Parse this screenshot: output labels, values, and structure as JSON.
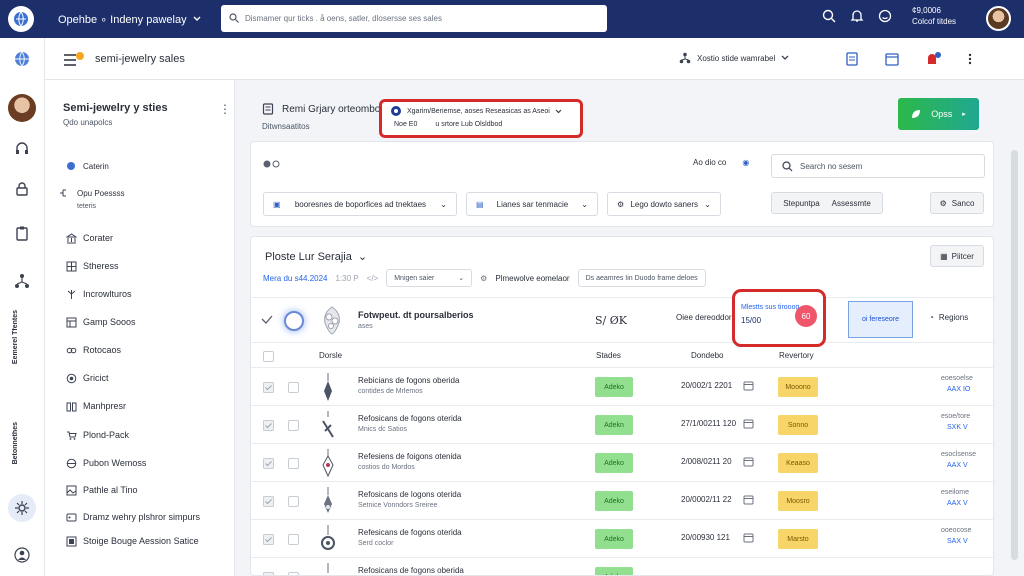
{
  "topbar": {
    "title": "Opehbe ∘ Indeny pawelay",
    "search_placeholder": "Dismamer qur ticks . å oens, satler, dlosersse ses sales",
    "status_line1": "¢9,0006",
    "status_line2": "Colcof titdes"
  },
  "rail": {
    "vtext1": "Eemerel Tfentes",
    "vtext2": "Betonnethes"
  },
  "subheader": {
    "title": "semi-jewelry sales",
    "right_label": "Xostio stide wamrabel"
  },
  "sidebar": {
    "title": "Semi-jewelry y sties",
    "subtitle": "Qdo unapolcs",
    "section_label": "Caterin",
    "section2_title": "Opu Poessss",
    "section2_sub": "teteris",
    "items": [
      "Corater",
      "Stheress",
      "Incrowlturos",
      "Gamp Sooos",
      "Rotocaos",
      "Gricict",
      "Manhpresr",
      "Plond-Pack",
      "Pubon Wemoss",
      "Pathle al Tino",
      "Dramz wehry plshror simpurs",
      "Stoige Bouge Aession Satice"
    ]
  },
  "main": {
    "title": "Remi Grjary orteombo",
    "subtitle": "Ditwnsaatitos",
    "highlight_top": "Xgarim/Beriemse, aoses Reseasicas as Aseoi",
    "highlight_left": "Noe E0",
    "highlight_right": "u srtore Lub Olsldbod",
    "ops_label": "Opss"
  },
  "filters": {
    "mid_label": "Ao dio co",
    "search_placeholder": "Search no sesem",
    "dropdown1": "booresnes de boporfices ad tnektaes",
    "dropdown2": "Lianes sar tenmacie",
    "dropdown3": "Lego dowto saners",
    "btn_stepping": "Stepuntpa",
    "btn_assessment": "Assessmte",
    "btn_sanco": "Sanco"
  },
  "table": {
    "title": "Ploste Lur Serajia",
    "filter_button": "Piitcer",
    "date_filter": "Mera du s44.2024",
    "time_filter": "1:30 P",
    "chip1": "Mnigen saier",
    "chip2_label": "Plmewolve eomelaor",
    "chip3": "Ds aeamres Iin Duodo frame deloes",
    "feature": {
      "name": "Fotwpeut. dt poursalberios",
      "sub": "ases",
      "code": "S/ ØK",
      "label": "Oiee dereoddor",
      "red_top": "Mlestts sus tirooog",
      "red_value": "15/00",
      "red_badge": "60",
      "blue_box": "oi fereseore",
      "regions": "Regions"
    },
    "headers": {
      "details": "Dorsle",
      "status": "Stades",
      "date": "Dondebo",
      "inventory": "Revertory"
    },
    "rows": [
      {
        "name": "Rebicians de fogons oberida",
        "sub": "contides de Mrlemos",
        "status": "Adeko",
        "date": "20/002/1 2201",
        "inventory": "Mooono",
        "r1": "eoesoelse",
        "r2": "AAX IO"
      },
      {
        "name": "Refosicans de fogons oterida",
        "sub": "Mnics dc Satios",
        "status": "Adekn",
        "date": "27/1/00211 120",
        "inventory": "Sonno",
        "r1": "esoe/tore",
        "r2": "SXK V"
      },
      {
        "name": "Refesiens de foigons otenida",
        "sub": "costios do Mordos",
        "status": "Adeko",
        "date": "2/008/0211 20",
        "inventory": "Keaaso",
        "r1": "esoclsense",
        "r2": "AAX V"
      },
      {
        "name": "Refosicans de logons oterida",
        "sub": "Setnice Vonndors Sreiree",
        "status": "Adeko",
        "date": "20/0002/11 22",
        "inventory": "Moosro",
        "r1": "eseilome",
        "r2": "AAX V"
      },
      {
        "name": "Refesicans de fogons oterida",
        "sub": "Serd coclor",
        "status": "Adeko",
        "date": "20/00930 121",
        "inventory": "Marsto",
        "r1": "ooeocose",
        "r2": "SAX V"
      },
      {
        "name": "Refosicans de fogons oberida",
        "sub": "",
        "status": "Adeko",
        "date": "",
        "inventory": "",
        "r1": "",
        "r2": ""
      }
    ]
  }
}
